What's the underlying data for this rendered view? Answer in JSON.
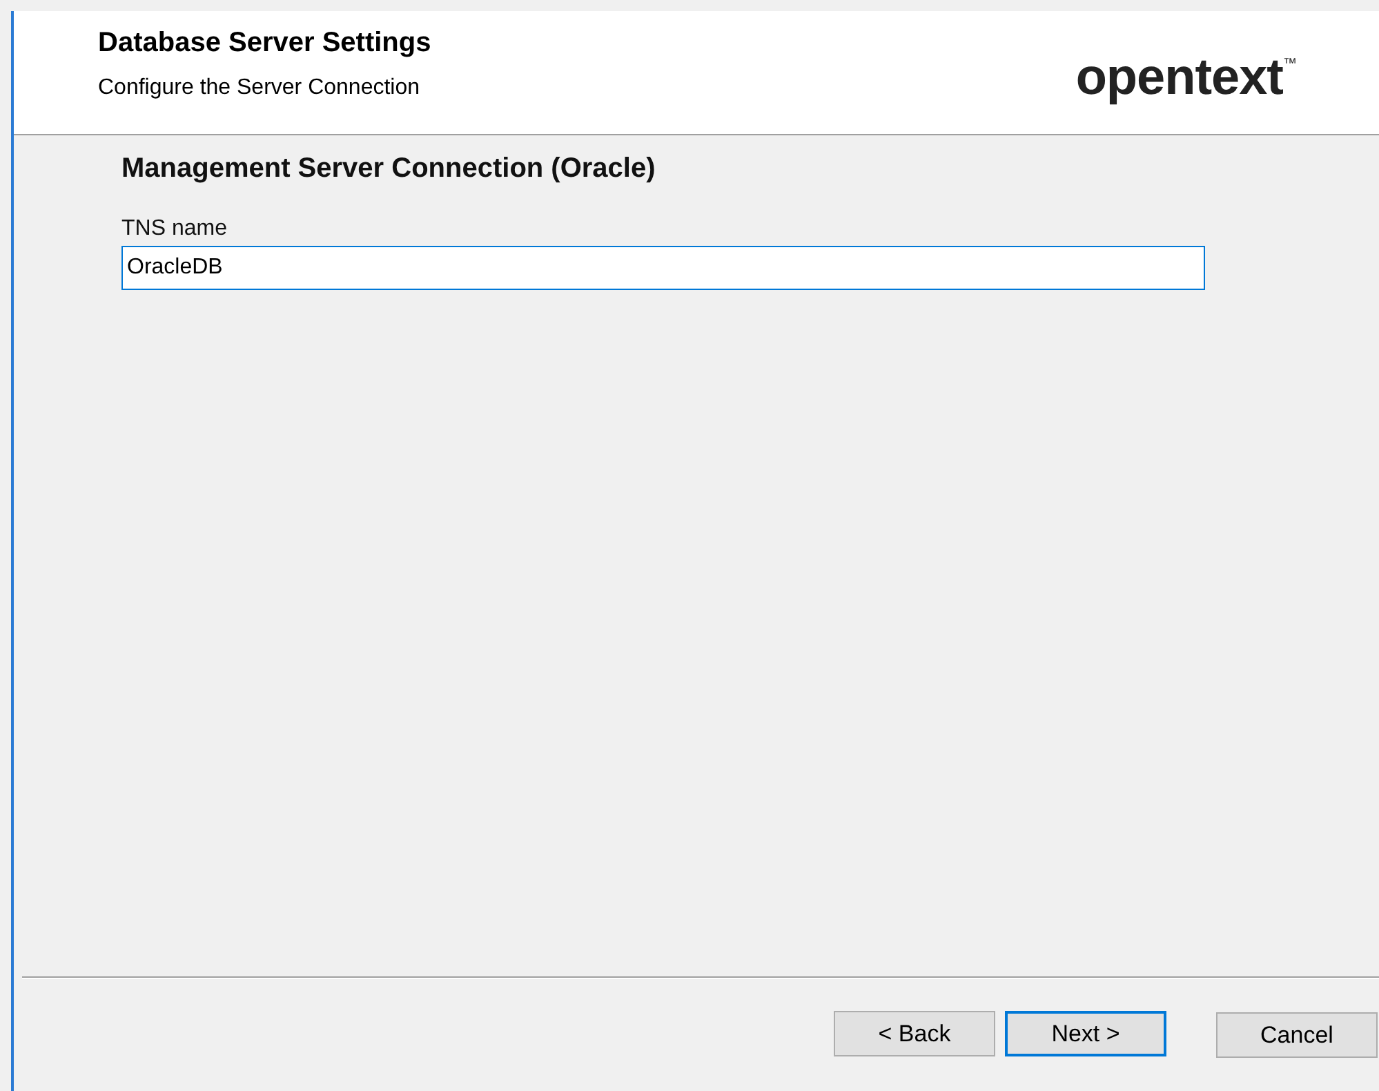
{
  "header": {
    "title": "Database Server Settings",
    "subtitle": "Configure the Server Connection",
    "logo": {
      "text": "opentext",
      "mark": "™"
    }
  },
  "section": {
    "title": "Management Server Connection (Oracle)"
  },
  "fields": [
    {
      "label": "TNS name",
      "value": "OracleDB",
      "focused": true
    }
  ],
  "buttons": [
    {
      "label": "< Back",
      "focused": false
    },
    {
      "label": "Next >",
      "focused": true
    },
    {
      "label": "Cancel",
      "focused": false
    }
  ]
}
